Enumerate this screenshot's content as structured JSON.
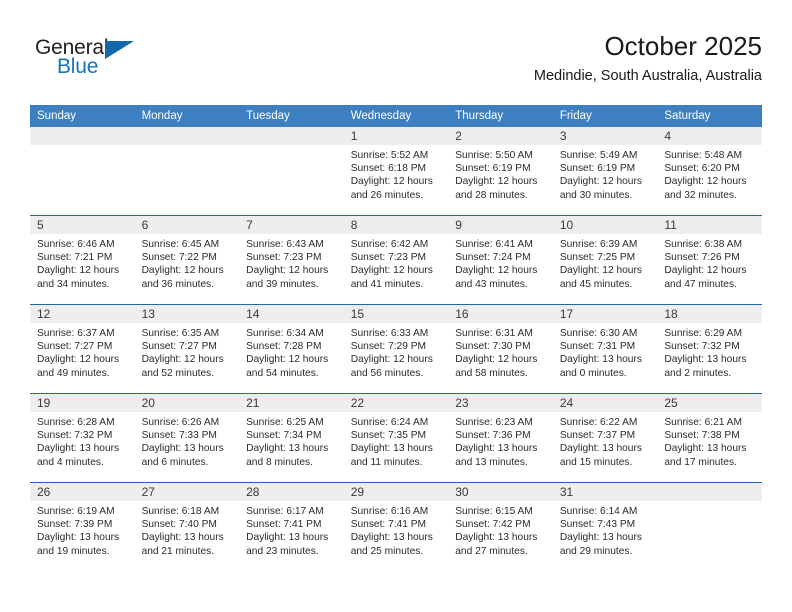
{
  "branding": {
    "logo_primary": "General",
    "logo_secondary": "Blue",
    "logo_accent_color": "#1168ad",
    "logo_text_color": "#231f20"
  },
  "header": {
    "title": "October 2025",
    "subtitle": "Medindie, South Australia, Australia"
  },
  "theme": {
    "header_row_bg": "#3d7fc1",
    "header_row_text": "#ffffff",
    "row_divider": "#1f68b0",
    "daynum_band_bg": "#eeeeee",
    "cell_bg": "#ffffff"
  },
  "weekday_headers": [
    "Sunday",
    "Monday",
    "Tuesday",
    "Wednesday",
    "Thursday",
    "Friday",
    "Saturday"
  ],
  "labels": {
    "sunrise_prefix": "Sunrise:",
    "sunset_prefix": "Sunset:",
    "daylight_prefix": "Daylight:"
  },
  "weeks": [
    [
      {
        "day": "",
        "empty": true
      },
      {
        "day": "",
        "empty": true
      },
      {
        "day": "",
        "empty": true
      },
      {
        "day": "1",
        "sunrise": "Sunrise: 5:52 AM",
        "sunset": "Sunset: 6:18 PM",
        "daylight_line1": "Daylight: 12 hours",
        "daylight_line2": "and 26 minutes."
      },
      {
        "day": "2",
        "sunrise": "Sunrise: 5:50 AM",
        "sunset": "Sunset: 6:19 PM",
        "daylight_line1": "Daylight: 12 hours",
        "daylight_line2": "and 28 minutes."
      },
      {
        "day": "3",
        "sunrise": "Sunrise: 5:49 AM",
        "sunset": "Sunset: 6:19 PM",
        "daylight_line1": "Daylight: 12 hours",
        "daylight_line2": "and 30 minutes."
      },
      {
        "day": "4",
        "sunrise": "Sunrise: 5:48 AM",
        "sunset": "Sunset: 6:20 PM",
        "daylight_line1": "Daylight: 12 hours",
        "daylight_line2": "and 32 minutes."
      }
    ],
    [
      {
        "day": "5",
        "sunrise": "Sunrise: 6:46 AM",
        "sunset": "Sunset: 7:21 PM",
        "daylight_line1": "Daylight: 12 hours",
        "daylight_line2": "and 34 minutes."
      },
      {
        "day": "6",
        "sunrise": "Sunrise: 6:45 AM",
        "sunset": "Sunset: 7:22 PM",
        "daylight_line1": "Daylight: 12 hours",
        "daylight_line2": "and 36 minutes."
      },
      {
        "day": "7",
        "sunrise": "Sunrise: 6:43 AM",
        "sunset": "Sunset: 7:23 PM",
        "daylight_line1": "Daylight: 12 hours",
        "daylight_line2": "and 39 minutes."
      },
      {
        "day": "8",
        "sunrise": "Sunrise: 6:42 AM",
        "sunset": "Sunset: 7:23 PM",
        "daylight_line1": "Daylight: 12 hours",
        "daylight_line2": "and 41 minutes."
      },
      {
        "day": "9",
        "sunrise": "Sunrise: 6:41 AM",
        "sunset": "Sunset: 7:24 PM",
        "daylight_line1": "Daylight: 12 hours",
        "daylight_line2": "and 43 minutes."
      },
      {
        "day": "10",
        "sunrise": "Sunrise: 6:39 AM",
        "sunset": "Sunset: 7:25 PM",
        "daylight_line1": "Daylight: 12 hours",
        "daylight_line2": "and 45 minutes."
      },
      {
        "day": "11",
        "sunrise": "Sunrise: 6:38 AM",
        "sunset": "Sunset: 7:26 PM",
        "daylight_line1": "Daylight: 12 hours",
        "daylight_line2": "and 47 minutes."
      }
    ],
    [
      {
        "day": "12",
        "sunrise": "Sunrise: 6:37 AM",
        "sunset": "Sunset: 7:27 PM",
        "daylight_line1": "Daylight: 12 hours",
        "daylight_line2": "and 49 minutes."
      },
      {
        "day": "13",
        "sunrise": "Sunrise: 6:35 AM",
        "sunset": "Sunset: 7:27 PM",
        "daylight_line1": "Daylight: 12 hours",
        "daylight_line2": "and 52 minutes."
      },
      {
        "day": "14",
        "sunrise": "Sunrise: 6:34 AM",
        "sunset": "Sunset: 7:28 PM",
        "daylight_line1": "Daylight: 12 hours",
        "daylight_line2": "and 54 minutes."
      },
      {
        "day": "15",
        "sunrise": "Sunrise: 6:33 AM",
        "sunset": "Sunset: 7:29 PM",
        "daylight_line1": "Daylight: 12 hours",
        "daylight_line2": "and 56 minutes."
      },
      {
        "day": "16",
        "sunrise": "Sunrise: 6:31 AM",
        "sunset": "Sunset: 7:30 PM",
        "daylight_line1": "Daylight: 12 hours",
        "daylight_line2": "and 58 minutes."
      },
      {
        "day": "17",
        "sunrise": "Sunrise: 6:30 AM",
        "sunset": "Sunset: 7:31 PM",
        "daylight_line1": "Daylight: 13 hours",
        "daylight_line2": "and 0 minutes."
      },
      {
        "day": "18",
        "sunrise": "Sunrise: 6:29 AM",
        "sunset": "Sunset: 7:32 PM",
        "daylight_line1": "Daylight: 13 hours",
        "daylight_line2": "and 2 minutes."
      }
    ],
    [
      {
        "day": "19",
        "sunrise": "Sunrise: 6:28 AM",
        "sunset": "Sunset: 7:32 PM",
        "daylight_line1": "Daylight: 13 hours",
        "daylight_line2": "and 4 minutes."
      },
      {
        "day": "20",
        "sunrise": "Sunrise: 6:26 AM",
        "sunset": "Sunset: 7:33 PM",
        "daylight_line1": "Daylight: 13 hours",
        "daylight_line2": "and 6 minutes."
      },
      {
        "day": "21",
        "sunrise": "Sunrise: 6:25 AM",
        "sunset": "Sunset: 7:34 PM",
        "daylight_line1": "Daylight: 13 hours",
        "daylight_line2": "and 8 minutes."
      },
      {
        "day": "22",
        "sunrise": "Sunrise: 6:24 AM",
        "sunset": "Sunset: 7:35 PM",
        "daylight_line1": "Daylight: 13 hours",
        "daylight_line2": "and 11 minutes."
      },
      {
        "day": "23",
        "sunrise": "Sunrise: 6:23 AM",
        "sunset": "Sunset: 7:36 PM",
        "daylight_line1": "Daylight: 13 hours",
        "daylight_line2": "and 13 minutes."
      },
      {
        "day": "24",
        "sunrise": "Sunrise: 6:22 AM",
        "sunset": "Sunset: 7:37 PM",
        "daylight_line1": "Daylight: 13 hours",
        "daylight_line2": "and 15 minutes."
      },
      {
        "day": "25",
        "sunrise": "Sunrise: 6:21 AM",
        "sunset": "Sunset: 7:38 PM",
        "daylight_line1": "Daylight: 13 hours",
        "daylight_line2": "and 17 minutes."
      }
    ],
    [
      {
        "day": "26",
        "sunrise": "Sunrise: 6:19 AM",
        "sunset": "Sunset: 7:39 PM",
        "daylight_line1": "Daylight: 13 hours",
        "daylight_line2": "and 19 minutes."
      },
      {
        "day": "27",
        "sunrise": "Sunrise: 6:18 AM",
        "sunset": "Sunset: 7:40 PM",
        "daylight_line1": "Daylight: 13 hours",
        "daylight_line2": "and 21 minutes."
      },
      {
        "day": "28",
        "sunrise": "Sunrise: 6:17 AM",
        "sunset": "Sunset: 7:41 PM",
        "daylight_line1": "Daylight: 13 hours",
        "daylight_line2": "and 23 minutes."
      },
      {
        "day": "29",
        "sunrise": "Sunrise: 6:16 AM",
        "sunset": "Sunset: 7:41 PM",
        "daylight_line1": "Daylight: 13 hours",
        "daylight_line2": "and 25 minutes."
      },
      {
        "day": "30",
        "sunrise": "Sunrise: 6:15 AM",
        "sunset": "Sunset: 7:42 PM",
        "daylight_line1": "Daylight: 13 hours",
        "daylight_line2": "and 27 minutes."
      },
      {
        "day": "31",
        "sunrise": "Sunrise: 6:14 AM",
        "sunset": "Sunset: 7:43 PM",
        "daylight_line1": "Daylight: 13 hours",
        "daylight_line2": "and 29 minutes."
      },
      {
        "day": "",
        "empty": true
      }
    ]
  ]
}
